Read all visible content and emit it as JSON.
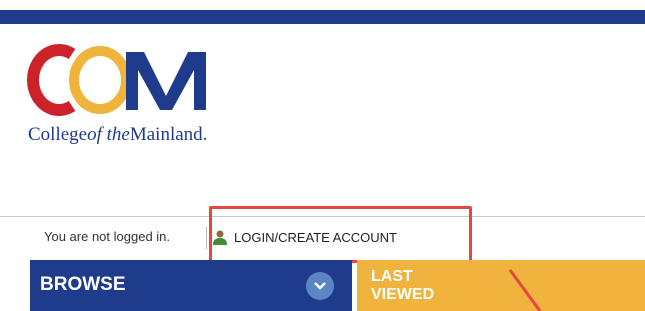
{
  "logo": {
    "letters": "COM",
    "wordmark_part1": "College",
    "wordmark_part2": "of the",
    "wordmark_part3": "Mainland."
  },
  "status": {
    "not_logged_in_text": "You are not logged in.",
    "login_link_text": "LOGIN/CREATE ACCOUNT"
  },
  "nav": {
    "browse_label": "BROWSE",
    "last_viewed_line1": "LAST",
    "last_viewed_line2": "VIEWED"
  },
  "colors": {
    "brand_navy": "#1f3b8c",
    "brand_gold": "#f0b33d",
    "logo_red": "#cc2229",
    "highlight_red": "#e5473e"
  },
  "icons": {
    "user": "user-icon",
    "chevron": "chevron-down-icon"
  }
}
